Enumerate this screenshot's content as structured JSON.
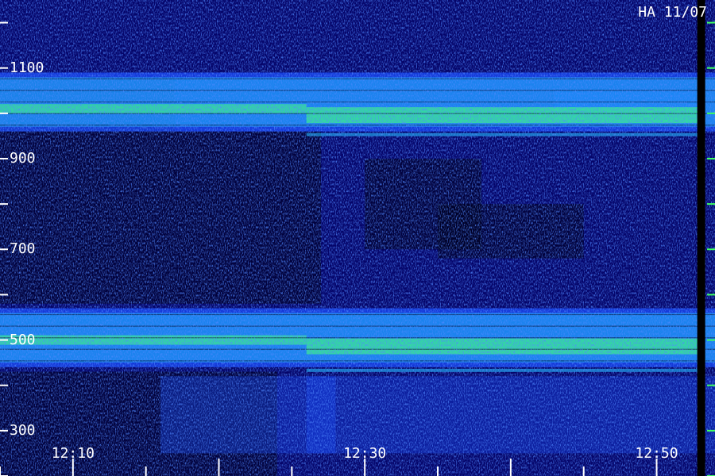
{
  "chart_data": {
    "type": "heatmap",
    "title": "HA 11/07",
    "xlabel": "",
    "ylabel": "",
    "x_tick_labels": [
      "12:10",
      "12:30",
      "12:50"
    ],
    "x_ticks_minutes": [
      "12:10",
      "12:30",
      "12:50"
    ],
    "x_range": [
      "12:05",
      "12:54"
    ],
    "y_tick_labels": [
      "1100",
      "900",
      "700",
      "500",
      "300"
    ],
    "y_ticks": [
      1100,
      900,
      700,
      500,
      300
    ],
    "y_range": [
      200,
      1250
    ],
    "x_minor_step_minutes": 5,
    "y_minor_step": 100,
    "grid": false,
    "colormap": [
      "#000018",
      "#0a10a0",
      "#1a4cff",
      "#20c0ff",
      "#40ff80"
    ],
    "bright_bands": [
      {
        "y_min": 960,
        "y_max": 1090,
        "peak_y": 1010,
        "intensity": 0.9
      },
      {
        "y_min": 440,
        "y_max": 570,
        "peak_y": 500,
        "intensity": 0.9
      }
    ],
    "events": [
      {
        "time": "12:26",
        "description": "band shift"
      },
      {
        "time": "12:53",
        "description": "data gap"
      }
    ]
  },
  "colors": {
    "background": "#00002a",
    "tick": "#ffffff",
    "right_tick": "#40ff60"
  }
}
